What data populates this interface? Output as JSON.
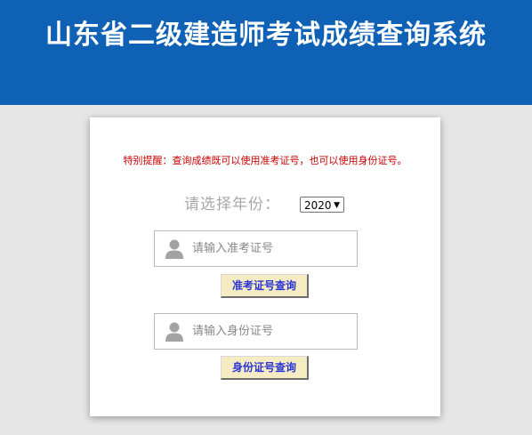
{
  "header": {
    "title": "山东省二级建造师考试成绩查询系统",
    "background_color": "#0f61b5"
  },
  "notice": {
    "text": "特别提醒：查询成绩既可以使用准考证号，也可以使用身份证号。",
    "color": "#cc0000"
  },
  "year": {
    "label": "请选择年份：",
    "selected": "2020"
  },
  "admission": {
    "placeholder": "请输入准考证号",
    "button_label": "准考证号查询",
    "icon": "user-icon"
  },
  "idcard": {
    "placeholder": "请输入身份证号",
    "button_label": "身份证号查询",
    "icon": "user-icon"
  }
}
